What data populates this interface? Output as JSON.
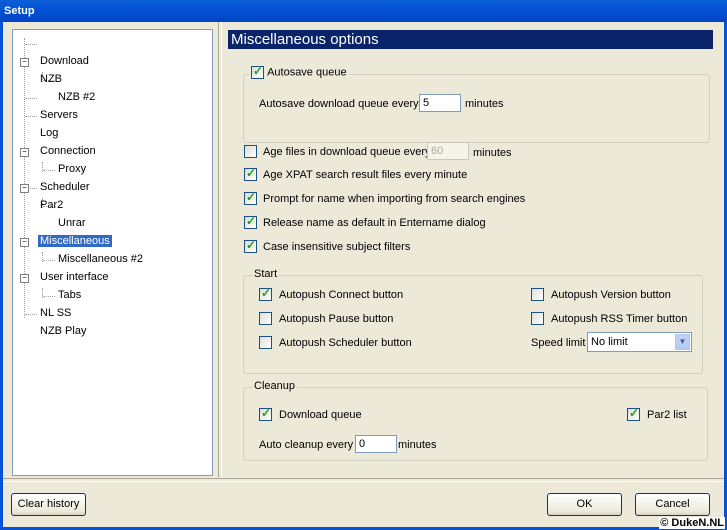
{
  "window": {
    "title": "Setup"
  },
  "tree": {
    "items": [
      {
        "label": "Download"
      },
      {
        "label": "NZB"
      },
      {
        "label": "NZB #2"
      },
      {
        "label": "Servers"
      },
      {
        "label": "Log"
      },
      {
        "label": "Connection"
      },
      {
        "label": "Proxy"
      },
      {
        "label": "Scheduler"
      },
      {
        "label": "Par2"
      },
      {
        "label": "Unrar"
      },
      {
        "label": "Miscellaneous",
        "selected": true
      },
      {
        "label": "Miscellaneous #2"
      },
      {
        "label": "User interface"
      },
      {
        "label": "Tabs"
      },
      {
        "label": "NL SS"
      },
      {
        "label": "NZB Play"
      }
    ]
  },
  "panel": {
    "title": "Miscellaneous options"
  },
  "autosave": {
    "label": "Autosave queue",
    "checked": true,
    "every_label": "Autosave download queue every",
    "every_value": "5",
    "unit": "minutes"
  },
  "options": {
    "age_files": {
      "label": "Age files in download queue every",
      "checked": false,
      "value": "60",
      "unit": "minutes"
    },
    "age_xpat": {
      "label": "Age XPAT search result files every minute",
      "checked": true
    },
    "prompt_name": {
      "label": "Prompt for name when importing from search engines",
      "checked": true
    },
    "release_name": {
      "label": "Release name as default in Entername dialog",
      "checked": true
    },
    "case_insensitive": {
      "label": "Case insensitive subject filters",
      "checked": true
    }
  },
  "start": {
    "title": "Start",
    "connect": {
      "label": "Autopush Connect button",
      "checked": true
    },
    "pause": {
      "label": "Autopush Pause button",
      "checked": false
    },
    "scheduler": {
      "label": "Autopush Scheduler button",
      "checked": false
    },
    "version": {
      "label": "Autopush Version button",
      "checked": false
    },
    "rss": {
      "label": "Autopush RSS Timer button",
      "checked": false
    },
    "speed_label": "Speed limit",
    "speed_value": "No limit"
  },
  "cleanup": {
    "title": "Cleanup",
    "download_queue": {
      "label": "Download queue",
      "checked": true
    },
    "par2_list": {
      "label": "Par2 list",
      "checked": true
    },
    "every_label": "Auto cleanup every",
    "every_value": "0",
    "unit": "minutes"
  },
  "buttons": {
    "clear_history": "Clear history",
    "ok": "OK",
    "cancel": "Cancel"
  },
  "copyright": "© DukeN.NL",
  "colors": {
    "title_bar": "#0453d6",
    "selection": "#316ac5",
    "header": "#0a246a",
    "check": "#21a121"
  }
}
